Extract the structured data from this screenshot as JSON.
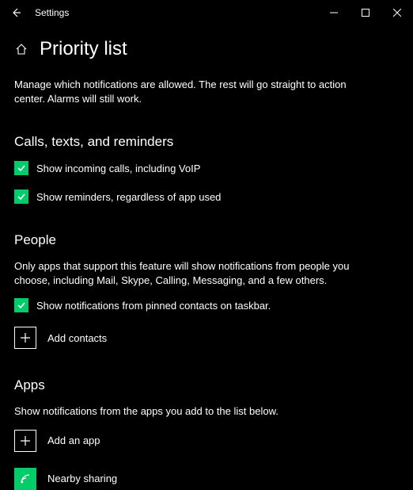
{
  "window": {
    "title": "Settings"
  },
  "page": {
    "title": "Priority list",
    "description": "Manage which notifications are allowed. The rest will go straight to action center. Alarms will still work."
  },
  "sections": {
    "calls": {
      "title": "Calls, texts, and reminders",
      "check1": "Show incoming calls, including VoIP",
      "check2": "Show reminders, regardless of app used"
    },
    "people": {
      "title": "People",
      "description": "Only apps that support this feature will show notifications from people you choose, including Mail, Skype, Calling, Messaging, and a few others.",
      "check1": "Show notifications from pinned contacts on taskbar.",
      "add_label": "Add contacts"
    },
    "apps": {
      "title": "Apps",
      "description": "Show notifications from the apps you add to the list below.",
      "add_label": "Add an app",
      "item1": "Nearby sharing"
    }
  },
  "colors": {
    "accent": "#00cc6a"
  }
}
